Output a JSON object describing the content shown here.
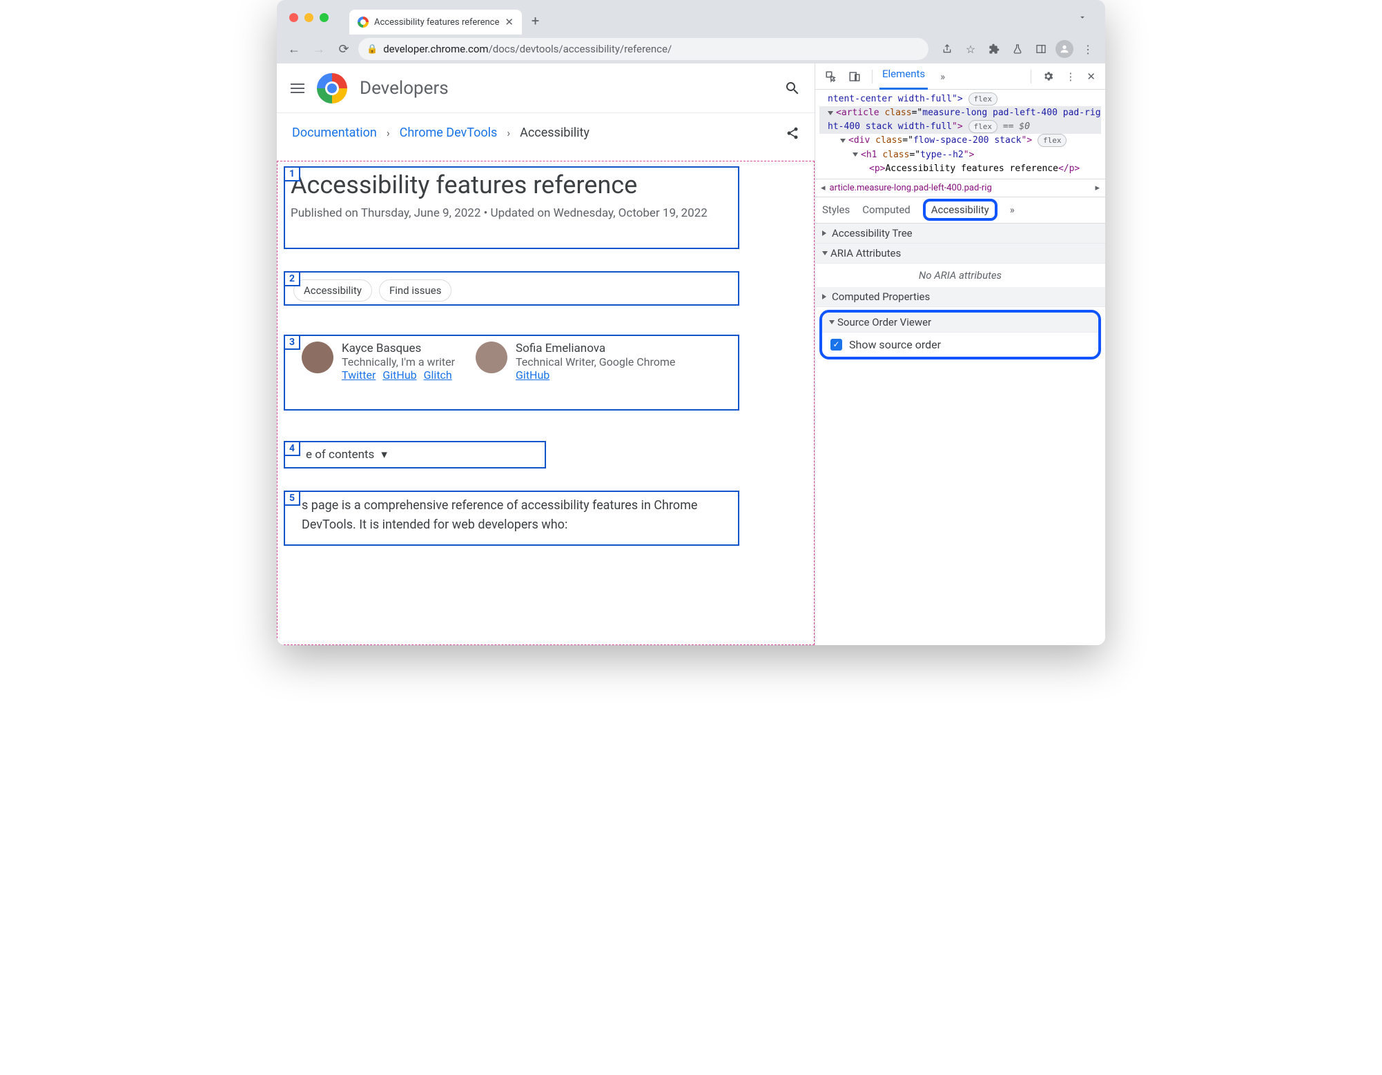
{
  "browser": {
    "tab_title": "Accessibility features reference",
    "url_host": "developer.chrome.com",
    "url_path": "/docs/devtools/accessibility/reference/"
  },
  "header": {
    "brand": "Developers"
  },
  "breadcrumbs": {
    "items": [
      "Documentation",
      "Chrome DevTools",
      "Accessibility"
    ]
  },
  "article": {
    "title": "Accessibility features reference",
    "meta": "Published on Thursday, June 9, 2022 • Updated on Wednesday, October 19, 2022",
    "chips": [
      "Accessibility",
      "Find issues"
    ],
    "toc_label": "e of contents",
    "intro": "s page is a comprehensive reference of accessibility features in Chrome DevTools. It is intended for web developers who:"
  },
  "authors": [
    {
      "name": "Kayce Basques",
      "role": "Technically, I'm a writer",
      "links": [
        "Twitter",
        "GitHub",
        "Glitch"
      ]
    },
    {
      "name": "Sofia Emelianova",
      "role": "Technical Writer, Google Chrome",
      "links": [
        "GitHub"
      ]
    }
  ],
  "devtools": {
    "main_tab": "Elements",
    "crumb": "article.measure-long.pad-left-400.pad-rig",
    "subtabs": [
      "Styles",
      "Computed",
      "Accessibility"
    ],
    "panes": {
      "tree": "Accessibility Tree",
      "aria": "ARIA Attributes",
      "aria_empty": "No ARIA attributes",
      "computed": "Computed Properties",
      "source": "Source Order Viewer",
      "show_source": "Show source order"
    },
    "dom": {
      "l1a": "ntent-center width-full\">",
      "l2_tag": "article",
      "l2_attr": "measure-long pad-left-400 pad-right-400 stack width-full",
      "l2_sel": "== $0",
      "l3_tag": "div",
      "l3_attr": "flow-space-200 stack",
      "l4_tag": "h1",
      "l4_attr": "type--h2",
      "l5_tag": "p",
      "l5_txt": "Accessibility features reference"
    }
  }
}
